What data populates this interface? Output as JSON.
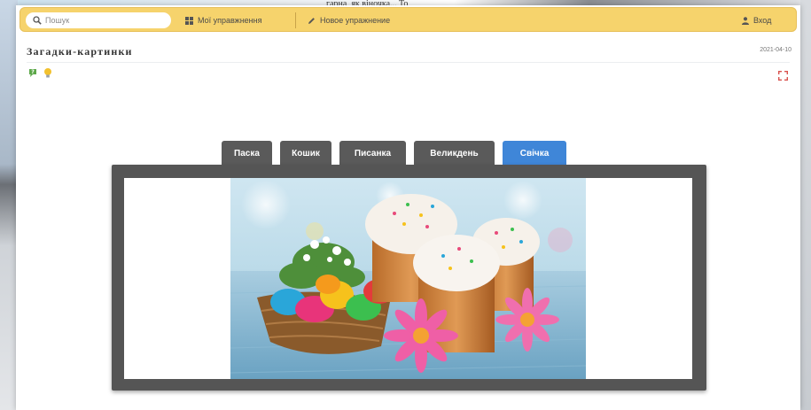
{
  "background": {
    "snippet": "гарна, як віночка... То"
  },
  "toolbar": {
    "search_placeholder": "Пошук",
    "all_exercises": "Мої управжнення",
    "new_exercise": "Новое упражнение",
    "login": "Вход"
  },
  "page": {
    "title": "Загадки-картинки",
    "date": "2021-04-10"
  },
  "tabs": [
    {
      "label": "Паска",
      "active": false
    },
    {
      "label": "Кошик",
      "active": false
    },
    {
      "label": "Писанка",
      "active": false
    },
    {
      "label": "Великдень",
      "active": false
    },
    {
      "label": "Свічка",
      "active": true
    }
  ],
  "colors": {
    "toolbar": "#f6d36c",
    "tab_inactive": "#5a5a5a",
    "tab_active": "#3f86d8",
    "frame": "#555555"
  },
  "icons": [
    "search-icon",
    "grid-icon",
    "pencil-icon",
    "user-icon",
    "help-icon",
    "lightbulb-icon",
    "fullscreen-icon"
  ]
}
